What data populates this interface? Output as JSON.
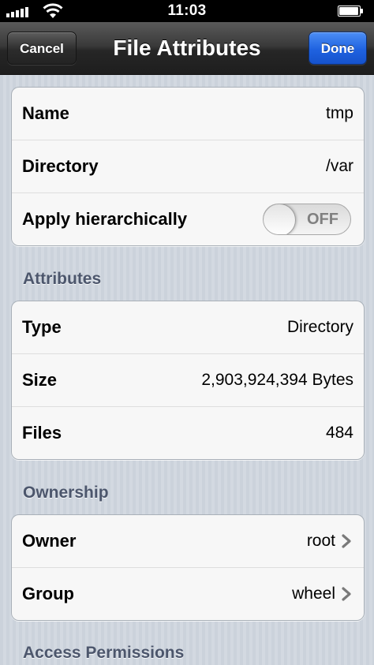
{
  "status_bar": {
    "time": "11:03",
    "signal_icon": "signal-bars-icon",
    "wifi_icon": "wifi-icon",
    "battery_icon": "battery-icon"
  },
  "nav": {
    "title": "File Attributes",
    "cancel_label": "Cancel",
    "done_label": "Done",
    "done_color": "#1f62e0"
  },
  "general": {
    "name_label": "Name",
    "name_value": "tmp",
    "directory_label": "Directory",
    "directory_value": "/var",
    "apply_label": "Apply hierarchically",
    "apply_toggle_text": "OFF"
  },
  "attributes": {
    "header": "Attributes",
    "type_label": "Type",
    "type_value": "Directory",
    "size_label": "Size",
    "size_value": "2,903,924,394 Bytes",
    "files_label": "Files",
    "files_value": "484"
  },
  "ownership": {
    "header": "Ownership",
    "owner_label": "Owner",
    "owner_value": "root",
    "group_label": "Group",
    "group_value": "wheel"
  },
  "access": {
    "header": "Access Permissions"
  },
  "colors": {
    "section_header": "#4c566c",
    "background": "#cdd3dc"
  }
}
